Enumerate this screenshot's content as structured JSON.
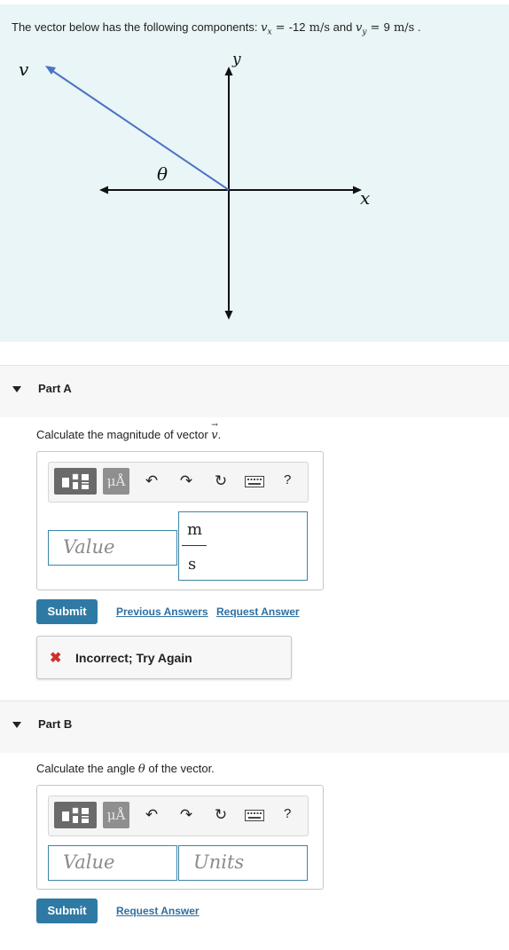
{
  "problem": {
    "prompt_prefix": "The vector below has the following components: ",
    "vx_symbol": "v",
    "vx_sub": "x",
    "vx_value": "-12",
    "vx_unit": "m/s",
    "and_text": " and ",
    "vy_symbol": "v",
    "vy_sub": "y",
    "vy_value": "9",
    "vy_unit": "m/s",
    "period": " .",
    "diagram": {
      "vector_label": "v",
      "angle_label": "θ",
      "x_axis_label": "x",
      "y_axis_label": "y",
      "vector_color": "#4a72c4"
    }
  },
  "part_a": {
    "title": "Part A",
    "question_prefix": "Calculate the magnitude of vector ",
    "question_symbol": "v",
    "question_suffix": ".",
    "toolbar": {
      "mu_label": "μÅ",
      "help_label": "?"
    },
    "value_placeholder": "Value",
    "unit_numerator": "m",
    "unit_denominator": "s",
    "submit_label": "Submit",
    "previous_answers_label": "Previous Answers",
    "request_answer_label": "Request Answer",
    "feedback": {
      "icon": "✖",
      "text": "Incorrect; Try Again",
      "color": "#d0312d"
    }
  },
  "part_b": {
    "title": "Part B",
    "question_prefix": "Calculate the angle ",
    "question_symbol": "θ",
    "question_suffix": " of the vector.",
    "toolbar": {
      "mu_label": "μÅ",
      "help_label": "?"
    },
    "value_placeholder": "Value",
    "units_placeholder": "Units",
    "submit_label": "Submit",
    "request_answer_label": "Request Answer"
  },
  "colors": {
    "accent": "#2f7aa4",
    "panel_bg": "#e9f5f6",
    "input_border": "#3d85a8"
  }
}
